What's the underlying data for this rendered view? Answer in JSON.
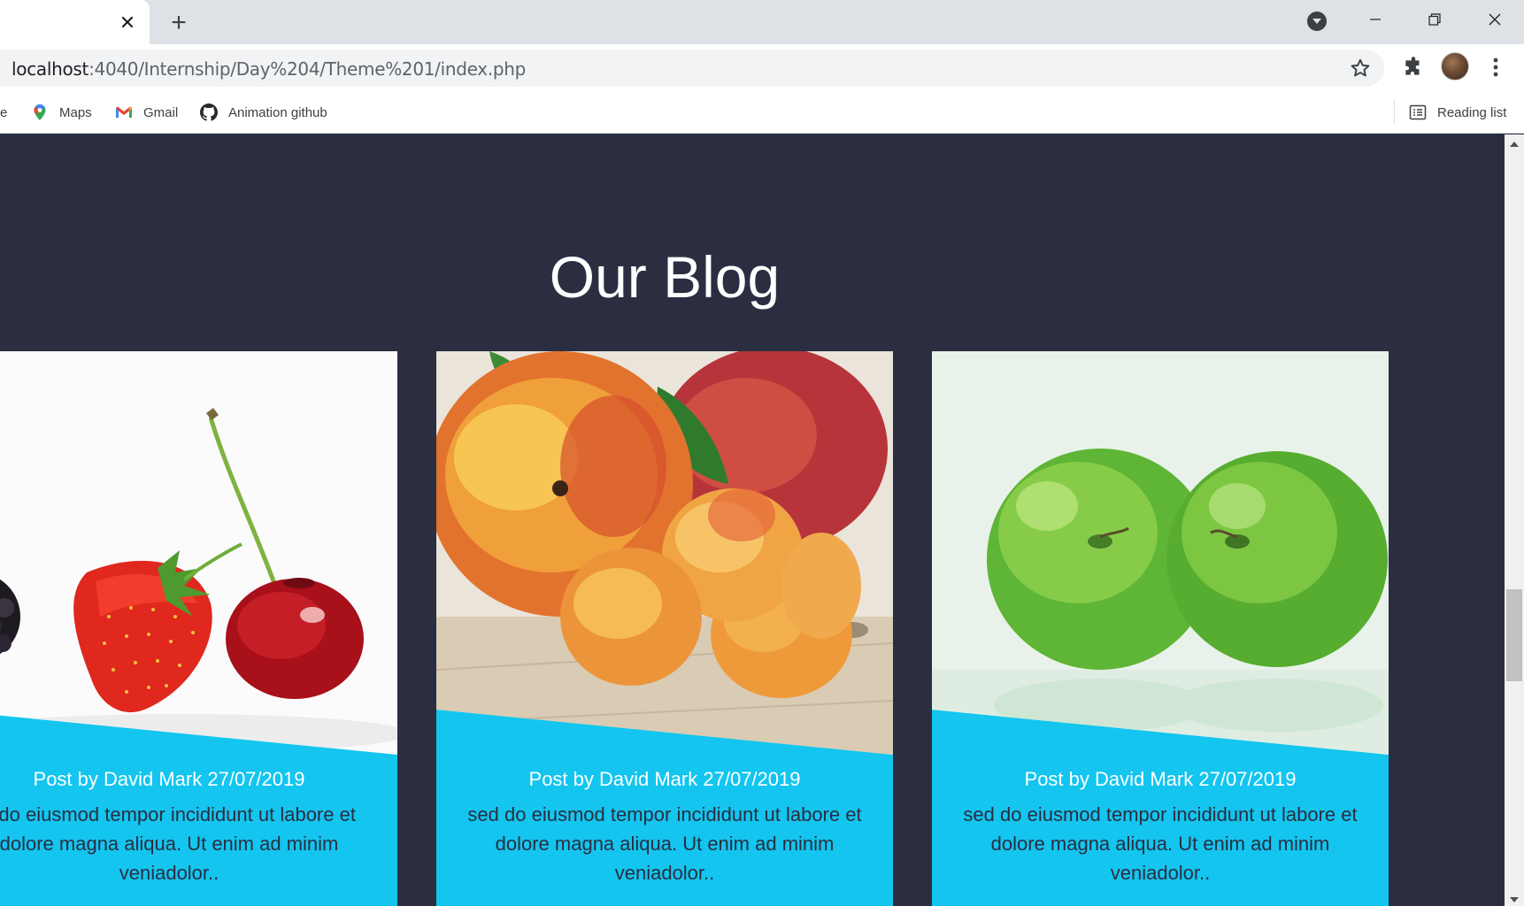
{
  "browser": {
    "tab_close_glyph": "✕",
    "new_tab_glyph": "+",
    "url_host": "localhost",
    "url_rest": ":4040/Internship/Day%204/Theme%201/index.php",
    "bookmarks": {
      "cut_label": "e",
      "maps_label": "Maps",
      "gmail_label": "Gmail",
      "github_label": "Animation github",
      "reading_list_label": "Reading list"
    }
  },
  "page": {
    "section_title": "Our Blog",
    "accent_color": "#13c5ef",
    "background_color": "#2a2e40",
    "posts": [
      {
        "image": "berries-strawberry-cherry",
        "meta": "Post by David Mark 27/07/2019",
        "excerpt": "d do eiusmod tempor incididunt ut labore et dolore magna aliqua. Ut enim ad minim veniadolor.."
      },
      {
        "image": "peaches-apricots",
        "meta": "Post by David Mark 27/07/2019",
        "excerpt": "sed do eiusmod tempor incididunt ut labore et dolore magna aliqua. Ut enim ad minim veniadolor.."
      },
      {
        "image": "green-apples",
        "meta": "Post by David Mark 27/07/2019",
        "excerpt": "sed do eiusmod tempor incididunt ut labore et dolore magna aliqua. Ut enim ad minim veniadolor.."
      }
    ]
  },
  "icons": {
    "star": "star-icon",
    "extensions": "puzzle-icon",
    "menu": "kebab-menu-icon",
    "maps": "maps-pin-icon",
    "gmail": "gmail-icon",
    "github": "github-icon",
    "reading_list": "reading-list-icon"
  }
}
